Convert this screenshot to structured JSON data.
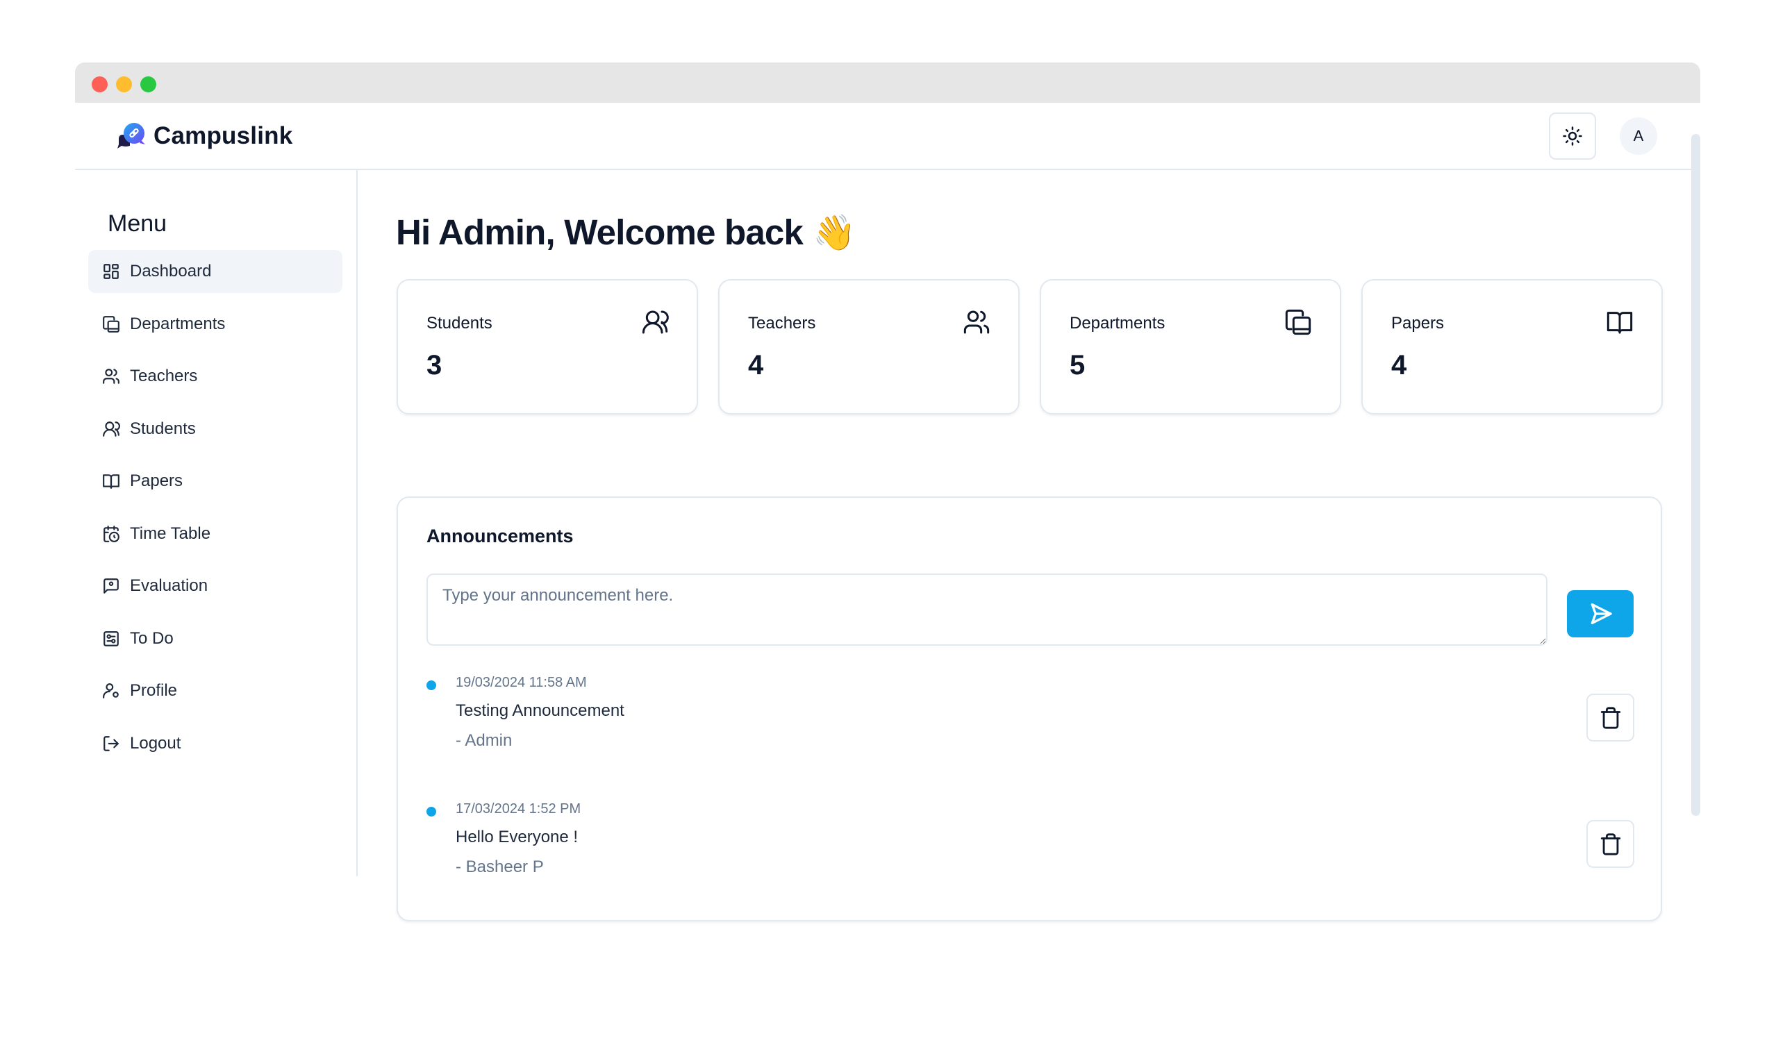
{
  "window": {
    "controls": [
      "close",
      "minimize",
      "maximize"
    ]
  },
  "header": {
    "brand_name": "Campuslink",
    "logo_icon": "chat-link-logo",
    "theme_toggle_icon": "sun-icon",
    "avatar_initial": "A"
  },
  "sidebar": {
    "title": "Menu",
    "active_item": "Dashboard",
    "items": [
      {
        "label": "Dashboard",
        "icon": "dashboard-grid-icon"
      },
      {
        "label": "Departments",
        "icon": "departments-icon"
      },
      {
        "label": "Teachers",
        "icon": "users-icon"
      },
      {
        "label": "Students",
        "icon": "users-round-icon"
      },
      {
        "label": "Papers",
        "icon": "book-open-icon"
      },
      {
        "label": "Time Table",
        "icon": "calendar-clock-icon"
      },
      {
        "label": "Evaluation",
        "icon": "message-square-icon"
      },
      {
        "label": "To Do",
        "icon": "todo-icon"
      },
      {
        "label": "Profile",
        "icon": "user-cog-icon"
      },
      {
        "label": "Logout",
        "icon": "logout-icon"
      }
    ]
  },
  "main": {
    "greeting": "Hi Admin, Welcome back",
    "greeting_emoji": "👋",
    "stats": [
      {
        "label": "Students",
        "value": "3",
        "icon": "users-round-icon"
      },
      {
        "label": "Teachers",
        "value": "4",
        "icon": "users-icon"
      },
      {
        "label": "Departments",
        "value": "5",
        "icon": "departments-icon"
      },
      {
        "label": "Papers",
        "value": "4",
        "icon": "book-open-icon"
      }
    ],
    "announcements": {
      "title": "Announcements",
      "input_placeholder": "Type your announcement here.",
      "input_value": "",
      "send_icon": "send-icon",
      "items": [
        {
          "time": "19/03/2024 11:58 AM",
          "text": "Testing Announcement",
          "author": "- Admin"
        },
        {
          "time": "17/03/2024 1:52 PM",
          "text": "Hello Everyone !",
          "author": "- Basheer P"
        }
      ]
    }
  },
  "colors": {
    "accent": "#0ea5e9",
    "text": "#0f172a",
    "muted": "#64748b",
    "border": "#e2e8f0",
    "active_bg": "#f1f5f9"
  }
}
